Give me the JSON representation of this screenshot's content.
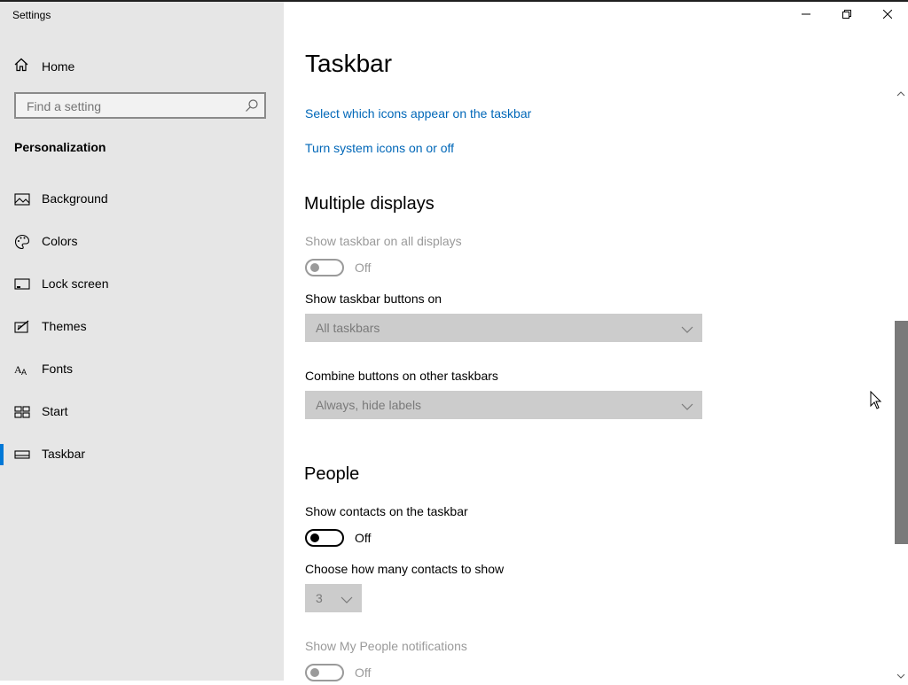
{
  "window": {
    "title": "Settings",
    "controls": [
      "minimize",
      "restore",
      "close"
    ]
  },
  "sidebar": {
    "home_label": "Home",
    "search_placeholder": "Find a setting",
    "section": "Personalization",
    "items": [
      {
        "label": "Background",
        "icon": "picture-icon"
      },
      {
        "label": "Colors",
        "icon": "palette-icon"
      },
      {
        "label": "Lock screen",
        "icon": "lock-screen-icon"
      },
      {
        "label": "Themes",
        "icon": "themes-icon"
      },
      {
        "label": "Fonts",
        "icon": "fonts-icon"
      },
      {
        "label": "Start",
        "icon": "start-icon"
      },
      {
        "label": "Taskbar",
        "icon": "taskbar-icon",
        "active": true
      }
    ],
    "accent": "#0078d7"
  },
  "main": {
    "title": "Taskbar",
    "links": [
      "Select which icons appear on the taskbar",
      "Turn system icons on or off"
    ],
    "multiple_displays": {
      "heading": "Multiple displays",
      "show_all_label": "Show taskbar on all displays",
      "show_all_state": "Off",
      "buttons_on_label": "Show taskbar buttons on",
      "buttons_on_value": "All taskbars",
      "combine_label": "Combine buttons on other taskbars",
      "combine_value": "Always, hide labels"
    },
    "people": {
      "heading": "People",
      "show_contacts_label": "Show contacts on the taskbar",
      "show_contacts_state": "Off",
      "how_many_label": "Choose how many contacts to show",
      "how_many_value": "3",
      "notifications_label": "Show My People notifications",
      "notifications_state": "Off"
    },
    "link_color": "#0067b8"
  }
}
